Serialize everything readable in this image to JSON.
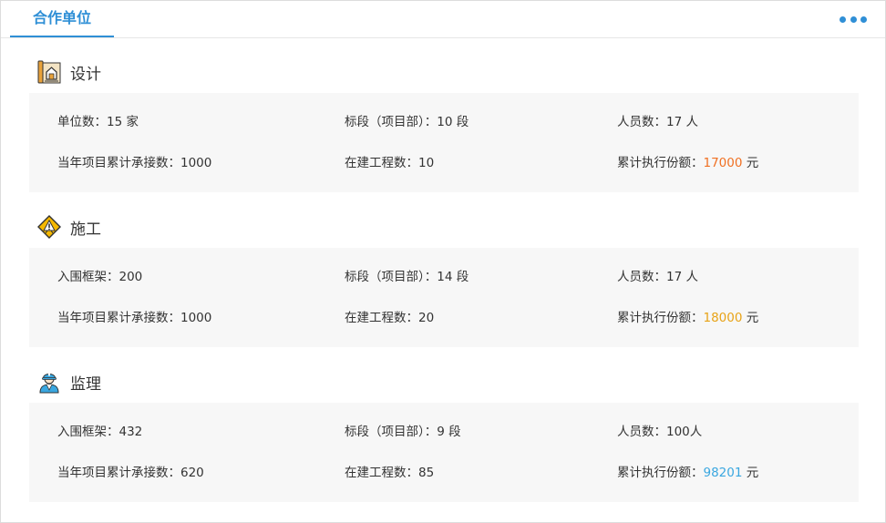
{
  "header": {
    "tab_label": "合作单位",
    "more_icon": "more-dots-icon"
  },
  "colors": {
    "accent": "#2f8fd6",
    "orange": "#f07022",
    "gold": "#e8a317",
    "cyan": "#3aa7e0"
  },
  "sections": [
    {
      "title": "设计",
      "icon": "blueprint-icon",
      "row1": {
        "a": "单位数：15 家",
        "b": "标段（项目部）：10 段",
        "c": "人员数：17 人"
      },
      "row2": {
        "a": "当年项目累计承接数：1000",
        "b": "在建工程数：10",
        "c_label": "累计执行份额：",
        "c_value": "17000",
        "c_unit": " 元"
      }
    },
    {
      "title": "施工",
      "icon": "construction-warning-icon",
      "row1": {
        "a": "入围框架：200",
        "b": "标段（项目部）：14 段",
        "c": "人员数：17 人"
      },
      "row2": {
        "a": "当年项目累计承接数：1000",
        "b": "在建工程数：20",
        "c_label": "累计执行份额：",
        "c_value": "18000",
        "c_unit": " 元"
      }
    },
    {
      "title": "监理",
      "icon": "supervisor-worker-icon",
      "row1": {
        "a": "入围框架：432",
        "b": "标段（项目部）：9 段",
        "c": "人员数：100人"
      },
      "row2": {
        "a": "当年项目累计承接数：620",
        "b": "在建工程数：85",
        "c_label": "累计执行份额：",
        "c_value": "98201",
        "c_unit": " 元"
      }
    }
  ]
}
